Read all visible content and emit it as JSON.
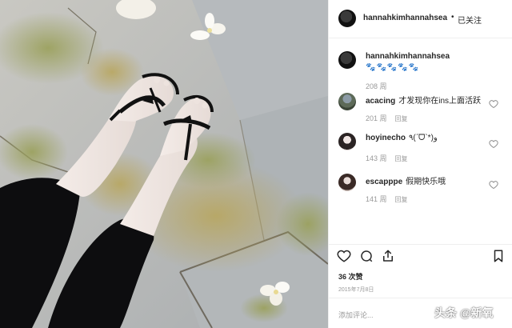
{
  "post": {
    "username": "hannahkimhannahsea",
    "separator": "•",
    "follow_status": "已关注"
  },
  "caption": {
    "username": "hannahkimhannahsea",
    "text": "🐾🐾🐾🐾🐾",
    "time": "208 周"
  },
  "comments": [
    {
      "username": "acacing",
      "text": "才发现你在ins上面活跃",
      "time": "201 周",
      "reply": "回复",
      "more": "..."
    },
    {
      "username": "hoyinecho",
      "text": "٩(ˊᗜˋ*)و",
      "time": "143 周",
      "reply": "回复"
    },
    {
      "username": "escapppe",
      "text": "假期快乐哦",
      "time": "141 周",
      "reply": "回复"
    }
  ],
  "actions": {
    "like_icon": "heart-icon",
    "comment_icon": "comment-icon",
    "share_icon": "share-icon",
    "save_icon": "bookmark-icon"
  },
  "likes": "36 次赞",
  "date": "2015年7月8日",
  "add_comment_placeholder": "添加评论...",
  "watermark": "头条 @新氧",
  "colors": {
    "text": "#262626",
    "muted": "#999999",
    "divider": "#efefef"
  }
}
